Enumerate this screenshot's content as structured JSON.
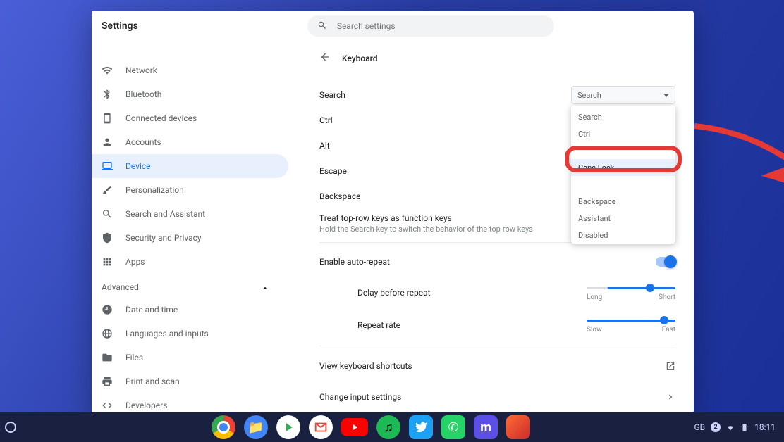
{
  "header": {
    "app_title": "Settings",
    "search_placeholder": "Search settings"
  },
  "sidebar": {
    "items": [
      {
        "label": "Network"
      },
      {
        "label": "Bluetooth"
      },
      {
        "label": "Connected devices"
      },
      {
        "label": "Accounts"
      },
      {
        "label": "Device"
      },
      {
        "label": "Personalization"
      },
      {
        "label": "Search and Assistant"
      },
      {
        "label": "Security and Privacy"
      },
      {
        "label": "Apps"
      }
    ],
    "advanced_label": "Advanced",
    "advanced_items": [
      {
        "label": "Date and time"
      },
      {
        "label": "Languages and inputs"
      },
      {
        "label": "Files"
      },
      {
        "label": "Print and scan"
      },
      {
        "label": "Developers"
      }
    ]
  },
  "page": {
    "title": "Keyboard",
    "rows": {
      "search": "Search",
      "ctrl": "Ctrl",
      "alt": "Alt",
      "escape": "Escape",
      "backspace": "Backspace"
    },
    "function_keys": {
      "title": "Treat top-row keys as function keys",
      "sub": "Hold the Search key to switch the behavior of the top-row keys"
    },
    "auto_repeat": "Enable auto-repeat",
    "delay": {
      "label": "Delay before repeat",
      "min": "Long",
      "max": "Short"
    },
    "rate": {
      "label": "Repeat rate",
      "min": "Slow",
      "max": "Fast"
    },
    "shortcuts": "View keyboard shortcuts",
    "input": "Change input settings"
  },
  "dropdown": {
    "selected": "Search",
    "options": [
      "Search",
      "Ctrl",
      "Caps Lock",
      "Backspace",
      "Assistant",
      "Disabled"
    ]
  },
  "shelf": {
    "status": {
      "lang": "GB",
      "notifications": "2",
      "time": "18:11"
    }
  }
}
